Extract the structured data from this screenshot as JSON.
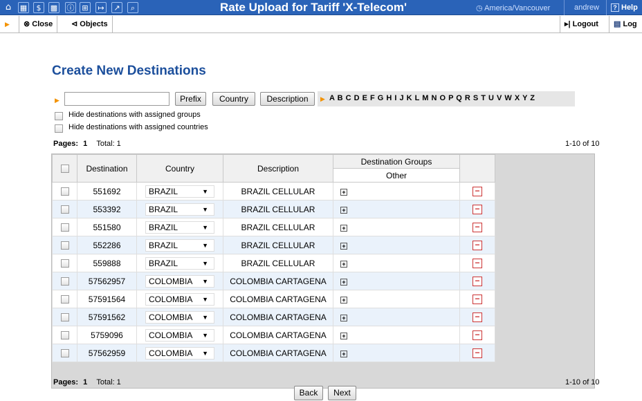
{
  "header": {
    "title": "Rate Upload for Tariff 'X-Telecom'",
    "timezone": "America/Vancouver",
    "user": "andrew",
    "help": "Help",
    "icons": [
      "home-icon",
      "grid-icon",
      "dollar-icon",
      "apps-icon",
      "info-icon",
      "table-icon",
      "export-icon",
      "chart-icon",
      "search-icon"
    ]
  },
  "toolbar": {
    "close": "Close",
    "objects": "Objects",
    "logout": "Logout",
    "log": "Log"
  },
  "page": {
    "heading": "Create New Destinations"
  },
  "filter": {
    "prefix_value": "",
    "prefix_btn": "Prefix",
    "country_btn": "Country",
    "description_btn": "Description",
    "letters": "A B C D E F G H I J K L M N O P Q R S T U V W X Y Z",
    "hide_groups": "Hide destinations with assigned groups",
    "hide_countries": "Hide destinations with assigned countries"
  },
  "pagination": {
    "pages_label": "Pages:",
    "current": "1",
    "total_label": "Total: 1",
    "range": "1-10 of 10"
  },
  "table": {
    "headers": {
      "destination": "Destination",
      "country": "Country",
      "description": "Description",
      "groups": "Destination Groups",
      "other": "Other"
    },
    "rows": [
      {
        "destination": "551692",
        "country": "BRAZIL",
        "description": "BRAZIL CELLULAR"
      },
      {
        "destination": "553392",
        "country": "BRAZIL",
        "description": "BRAZIL CELLULAR"
      },
      {
        "destination": "551580",
        "country": "BRAZIL",
        "description": "BRAZIL CELLULAR"
      },
      {
        "destination": "552286",
        "country": "BRAZIL",
        "description": "BRAZIL CELLULAR"
      },
      {
        "destination": "559888",
        "country": "BRAZIL",
        "description": "BRAZIL CELLULAR"
      },
      {
        "destination": "57562957",
        "country": "COLOMBIA",
        "description": "COLOMBIA CARTAGENA"
      },
      {
        "destination": "57591564",
        "country": "COLOMBIA",
        "description": "COLOMBIA CARTAGENA"
      },
      {
        "destination": "57591562",
        "country": "COLOMBIA",
        "description": "COLOMBIA CARTAGENA"
      },
      {
        "destination": "5759096",
        "country": "COLOMBIA",
        "description": "COLOMBIA CARTAGENA"
      },
      {
        "destination": "57562959",
        "country": "COLOMBIA",
        "description": "COLOMBIA CARTAGENA"
      }
    ]
  },
  "footer": {
    "back": "Back",
    "next": "Next"
  },
  "colors": {
    "header_bg": "#2a63b8",
    "heading": "#1c4f9c",
    "accent_arrow": "#f39200",
    "alt_row": "#eaf2fb"
  }
}
